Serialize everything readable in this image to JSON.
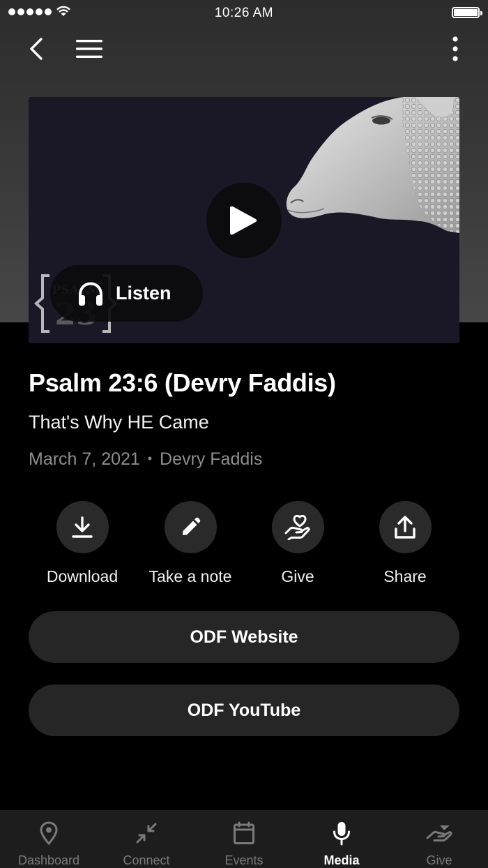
{
  "status_bar": {
    "time": "10:26 AM"
  },
  "hero": {
    "listen_label": "Listen",
    "logo_text_top": "PSALM",
    "logo_text_bottom": "23"
  },
  "sermon": {
    "title": "Psalm 23:6 (Devry Faddis)",
    "subtitle": "That's Why HE Came",
    "date": "March 7, 2021",
    "separator": "•",
    "speaker": "Devry Faddis"
  },
  "actions": [
    {
      "label": "Download",
      "icon": "download-icon"
    },
    {
      "label": "Take a note",
      "icon": "pencil-icon"
    },
    {
      "label": "Give",
      "icon": "giving-hand-heart-icon"
    },
    {
      "label": "Share",
      "icon": "share-upload-icon"
    }
  ],
  "links": [
    {
      "label": "ODF Website"
    },
    {
      "label": "ODF YouTube"
    }
  ],
  "tabs": [
    {
      "label": "Dashboard",
      "icon": "location-pin-icon",
      "active": false
    },
    {
      "label": "Connect",
      "icon": "connect-arrows-icon",
      "active": false
    },
    {
      "label": "Events",
      "icon": "calendar-icon",
      "active": false
    },
    {
      "label": "Media",
      "icon": "microphone-icon",
      "active": true
    },
    {
      "label": "Give",
      "icon": "giving-hand-icon",
      "active": false
    }
  ],
  "colors": {
    "background": "#000000",
    "header_gradient_top": "#2c2c2c",
    "hero_background": "#1a1827",
    "button_background": "#262626",
    "meta_text": "#8e8e8e",
    "tab_bar": "#1d1d1d",
    "tab_inactive": "#7a7a7a"
  }
}
